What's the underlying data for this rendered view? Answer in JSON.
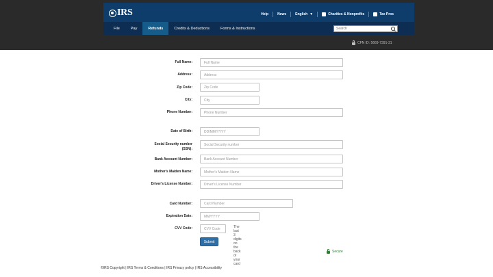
{
  "header": {
    "logo_text": "IRS",
    "utility": {
      "help": "Help",
      "news": "News",
      "language": "English",
      "charities": "Charities & Nonprofits",
      "tax_pros": "Tax Pros"
    },
    "nav": [
      "File",
      "Pay",
      "Refunds",
      "Credits & Deductions",
      "Forms & Instructions"
    ],
    "search_placeholder": "Search"
  },
  "cfn": "CFN ID: 5669-7391-31",
  "form": {
    "full_name": {
      "label": "Full Name:",
      "placeholder": "Full Name"
    },
    "address": {
      "label": "Address:",
      "placeholder": "Address"
    },
    "zip": {
      "label": "Zip Code:",
      "placeholder": "Zip Code"
    },
    "city": {
      "label": "City:",
      "placeholder": "City"
    },
    "phone": {
      "label": "Phone Number:",
      "placeholder": "Phone Number"
    },
    "dob": {
      "label": "Date of Birth:",
      "placeholder": "DD/MM/YYYY"
    },
    "ssn": {
      "label_line1": "Social Security number",
      "label_line2": "(SSN):",
      "placeholder": "Social Security number"
    },
    "bank": {
      "label": "Bank Account Number:",
      "placeholder": "Bank Account Number"
    },
    "maiden": {
      "label": "Mother's Maiden Name:",
      "placeholder": "Mother's Maiden Name"
    },
    "license": {
      "label": "Driver's License Number:",
      "placeholder": "Driver's License Number"
    },
    "card": {
      "label": "Card Number:",
      "placeholder": "Card Number"
    },
    "exp": {
      "label": "Expiration Date:",
      "placeholder": "MM/YYYY"
    },
    "cvv": {
      "label": "CVV Code:",
      "placeholder": "CVV Code",
      "hint": "The last 3 digits on the back of your card"
    },
    "submit": "Submit",
    "secure": "Secure"
  },
  "footer": "©IRS Copyright | IRS Terms & Conditions | IRS Privacy policy | IRS Accessibility",
  "colors": {
    "header_bg": "#0f3d6b",
    "nav_bg": "#0d2e52",
    "nav_active": "#155c8a",
    "submit_bg": "#2f6fa8",
    "secure_green": "#2e7d32"
  },
  "icons": [
    "irs-seal-icon",
    "chevron-down-icon",
    "charities-icon",
    "tax-pros-icon",
    "search-icon",
    "lock-icon"
  ]
}
